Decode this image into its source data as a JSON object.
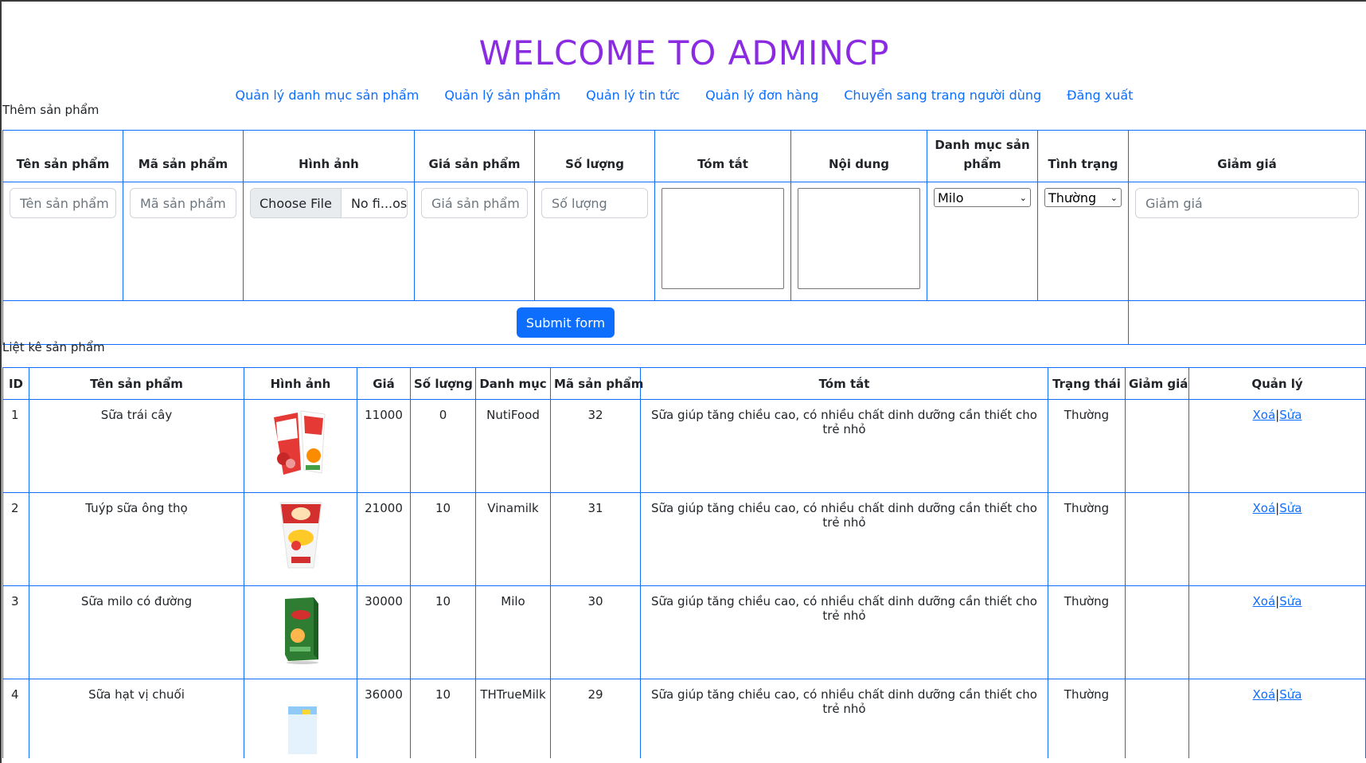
{
  "header": {
    "title": "WELCOME TO ADMINCP"
  },
  "nav": [
    "Quản lý danh mục sản phẩm",
    "Quản lý sản phẩm",
    "Quản lý tin tức",
    "Quản lý đơn hàng",
    "Chuyển sang trang người dùng",
    "Đăng xuất"
  ],
  "add_form": {
    "section_label": "Thêm sản phẩm",
    "headers": [
      "Tên sản phẩm",
      "Mã sản phẩm",
      "Hình ảnh",
      "Giá sản phẩm",
      "Số lượng",
      "Tóm tắt",
      "Nội dung",
      "Danh mục sản phẩm",
      "Tình trạng",
      "Giảm giá"
    ],
    "placeholders": {
      "name": "Tên sản phẩm",
      "code": "Mã sản phẩm",
      "price": "Giá sản phẩm",
      "quantity": "Số lượng",
      "discount": "Giảm giá"
    },
    "file_button": "Choose File",
    "file_name": "No fi...osen",
    "category_selected": "Milo",
    "status_selected": "Thường",
    "submit_label": "Submit form"
  },
  "list": {
    "section_label": "Liệt kê sản phẩm",
    "headers": [
      "ID",
      "Tên sản phẩm",
      "Hình ảnh",
      "Giá",
      "Số lượng",
      "Danh mục",
      "Mã sản phẩm",
      "Tóm tắt",
      "Trạng thái",
      "Giảm giá",
      "Quản lý"
    ],
    "delete_label": "Xoá",
    "separator": "|",
    "edit_label": "Sửa",
    "rows": [
      {
        "id": "1",
        "name": "Sữa trái cây",
        "price": "11000",
        "quantity": "0",
        "category": "NutiFood",
        "code": "32",
        "summary": "Sữa giúp tăng chiều cao, có nhiều chất dinh dưỡng cần thiết cho trẻ nhỏ",
        "status": "Thường",
        "discount": "",
        "image": "nutifood-fruit-milk-image"
      },
      {
        "id": "2",
        "name": "Tuýp sữa ông thọ",
        "price": "21000",
        "quantity": "10",
        "category": "Vinamilk",
        "code": "31",
        "summary": "Sữa giúp tăng chiều cao, có nhiều chất dinh dưỡng cần thiết cho trẻ nhỏ",
        "status": "Thường",
        "discount": "",
        "image": "ong-tho-milk-tube-image"
      },
      {
        "id": "3",
        "name": "Sữa milo có đường",
        "price": "30000",
        "quantity": "10",
        "category": "Milo",
        "code": "30",
        "summary": "Sữa giúp tăng chiều cao, có nhiều chất dinh dưỡng cần thiết cho trẻ nhỏ",
        "status": "Thường",
        "discount": "",
        "image": "milo-box-image"
      },
      {
        "id": "4",
        "name": "Sữa hạt vị chuối",
        "price": "36000",
        "quantity": "10",
        "category": "THTrueMilk",
        "code": "29",
        "summary": "Sữa giúp tăng chiều cao, có nhiều chất dinh dưỡng cần thiết cho trẻ nhỏ",
        "status": "Thường",
        "discount": "",
        "image": "th-truemilk-banana-image"
      }
    ]
  },
  "colors": {
    "title": "#8a2be2",
    "link": "#0d6efd",
    "border": "#0d6efd",
    "button": "#0d6efd"
  }
}
